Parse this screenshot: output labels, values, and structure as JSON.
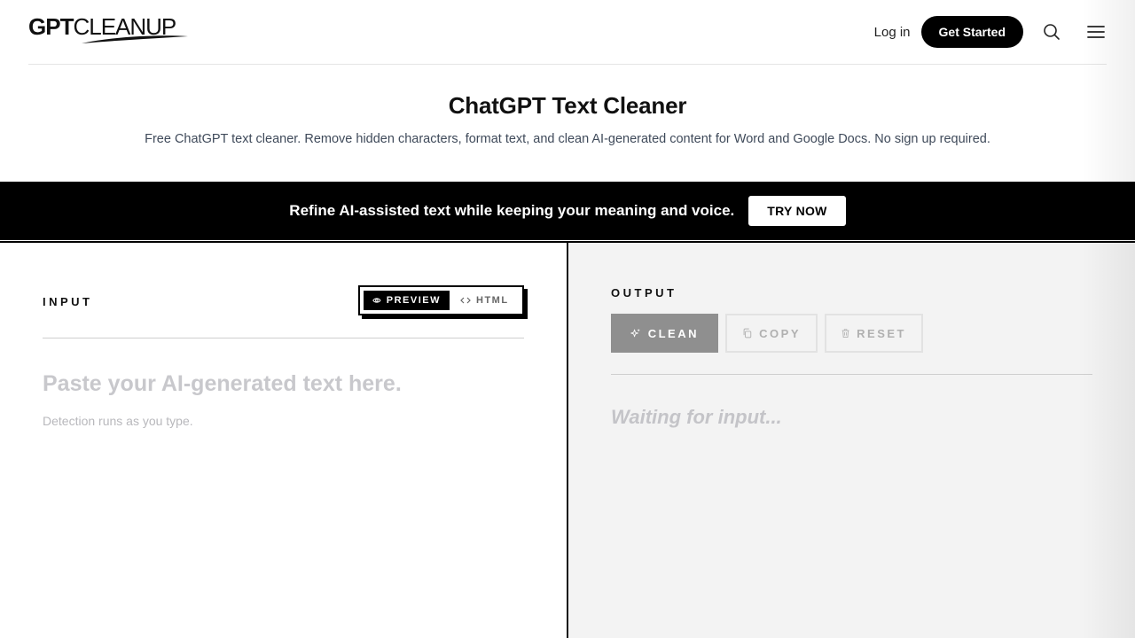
{
  "header": {
    "logo_bold": "GPT",
    "logo_light": "CLEANUP",
    "login_label": "Log in",
    "cta_label": "Get Started"
  },
  "hero": {
    "title": "ChatGPT Text Cleaner",
    "subtitle": "Free ChatGPT text cleaner. Remove hidden characters, format text, and clean AI-generated content for Word and Google Docs. No sign up required."
  },
  "banner": {
    "text": "Refine AI-assisted text while keeping your meaning and voice.",
    "button_label": "TRY NOW"
  },
  "input_panel": {
    "label": "INPUT",
    "toggle": {
      "preview_label": "PREVIEW",
      "html_label": "HTML",
      "active": "preview"
    },
    "placeholder_title": "Paste your AI-generated text here.",
    "placeholder_hint": "Detection runs as you type."
  },
  "output_panel": {
    "label": "OUTPUT",
    "clean_label": "CLEAN",
    "copy_label": "COPY",
    "reset_label": "RESET",
    "waiting_text": "Waiting for input..."
  },
  "icons": {
    "search": "search-icon",
    "menu": "hamburger-menu-icon",
    "preview": "eye-icon",
    "html": "code-icon",
    "clean": "sparkles-icon",
    "copy": "copy-icon",
    "reset": "trash-icon"
  },
  "colors": {
    "accent": "#000000",
    "output_bg": "#f3f3f3",
    "clean_button": "#8f8f8f"
  }
}
